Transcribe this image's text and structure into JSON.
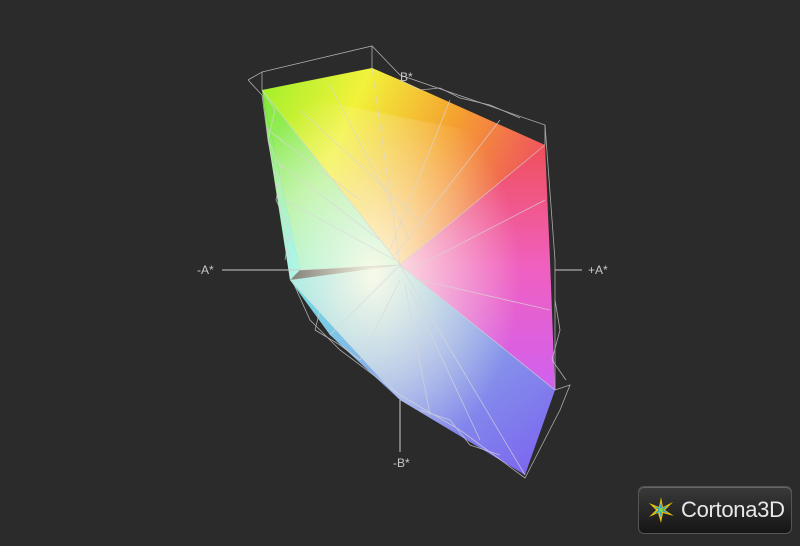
{
  "viewer": {
    "axis_labels": {
      "neg_a": "-A*",
      "pos_a": "+A*",
      "pos_b": "B*",
      "neg_b": "-B*"
    },
    "brand": {
      "name": "Cortona3D",
      "icon": "cortona-star-icon"
    },
    "colors": {
      "background": "#2b2b2b",
      "axis": "#c8c8c8",
      "wireframe": "#d8d8d8"
    }
  }
}
